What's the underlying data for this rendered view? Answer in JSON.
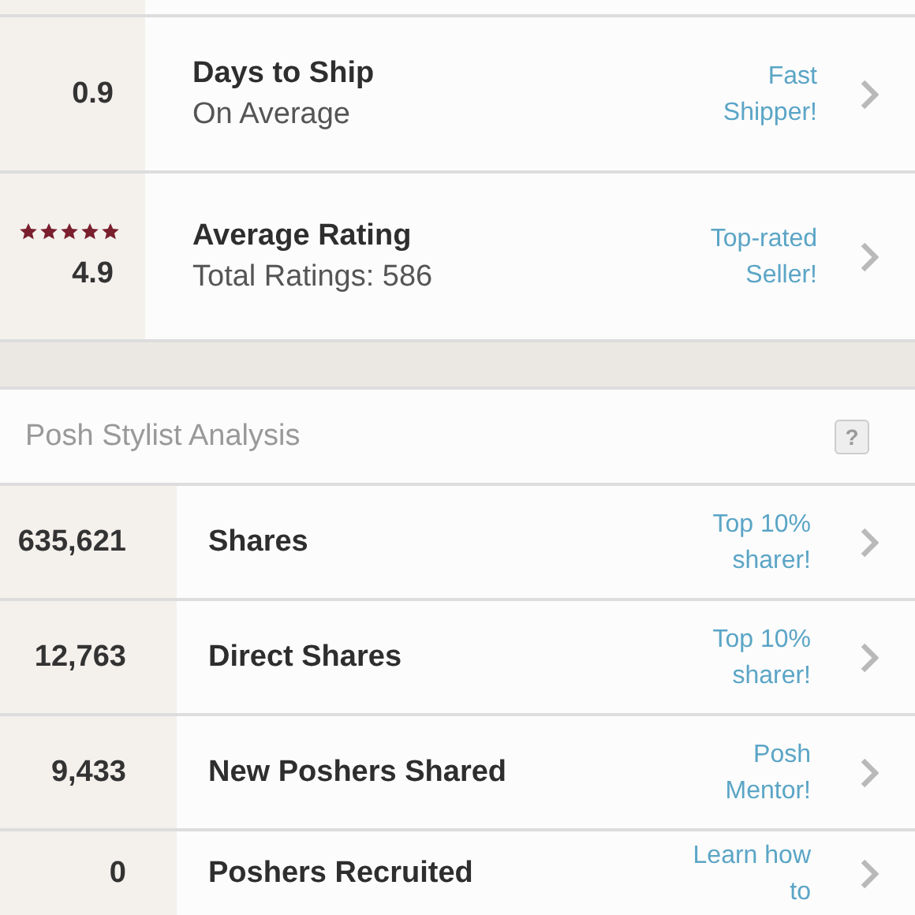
{
  "seller_stats": [
    {
      "kind": "plain",
      "value": "0.9",
      "title": "Days to Ship",
      "subtitle": "On Average",
      "badge": "Fast Shipper!"
    },
    {
      "kind": "rating",
      "stars": 5,
      "value": "4.9",
      "title": "Average Rating",
      "subtitle": "Total Ratings: 586",
      "badge": "Top-rated Seller!"
    }
  ],
  "stylist_analysis": {
    "title": "Posh Stylist Analysis",
    "help_icon": "?",
    "rows": [
      {
        "value": "635,621",
        "label": "Shares",
        "badge": "Top 10% sharer!"
      },
      {
        "value": "12,763",
        "label": "Direct Shares",
        "badge": "Top 10% sharer!"
      },
      {
        "value": "9,433",
        "label": "New Poshers Shared",
        "badge": "Posh Mentor!"
      },
      {
        "value": "0",
        "label": "Poshers Recruited",
        "badge": "Learn how to"
      }
    ]
  }
}
